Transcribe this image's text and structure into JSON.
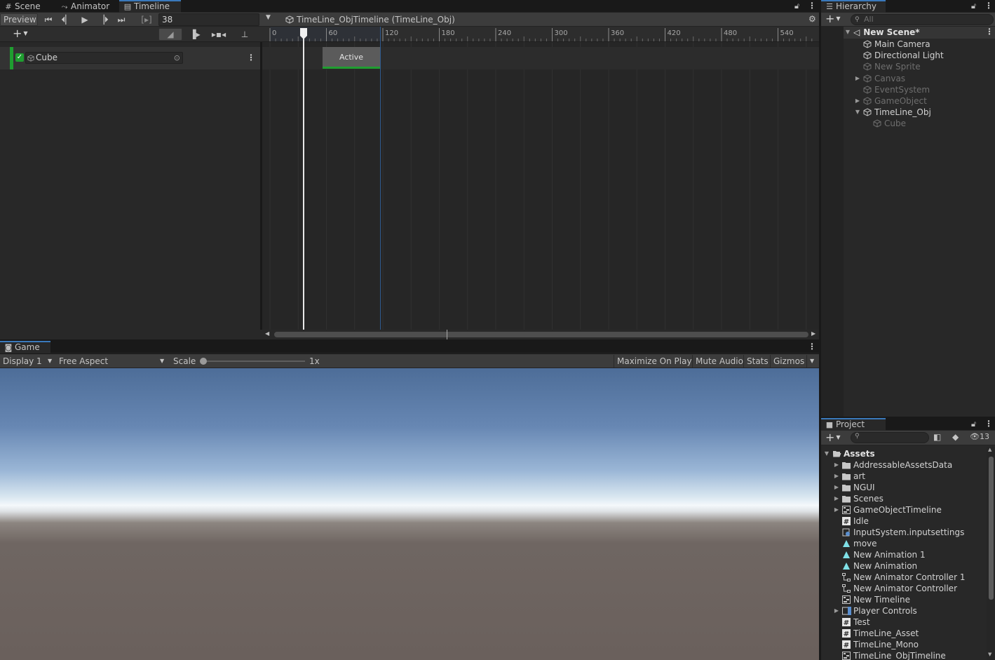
{
  "timeline_window": {
    "tabs": [
      {
        "label": "Scene",
        "icon": "grid-icon"
      },
      {
        "label": "Animator",
        "icon": "animator-icon"
      },
      {
        "label": "Timeline",
        "icon": "timeline-icon",
        "active": true
      }
    ],
    "preview_label": "Preview",
    "frame_value": "38",
    "breadcrumb": "TimeLine_ObjTimeline (TimeLine_Obj)",
    "track": {
      "name": "Cube",
      "enabled": true
    },
    "clip": {
      "label": "Active"
    },
    "ruler_ticks": [
      "0",
      "60",
      "120",
      "180",
      "240",
      "300",
      "360",
      "420",
      "480",
      "540"
    ],
    "add_button": "+"
  },
  "game_window": {
    "tab_label": "Game",
    "display_select": "Display 1",
    "aspect_select": "Free Aspect",
    "scale_label": "Scale",
    "scale_value": "1x",
    "maximize_label": "Maximize On Play",
    "mute_label": "Mute Audio",
    "stats_label": "Stats",
    "gizmos_label": "Gizmos"
  },
  "hierarchy": {
    "tab_label": "Hierarchy",
    "search_placeholder": "All",
    "scene_name": "New Scene*",
    "items": [
      {
        "label": "Main Camera",
        "active": true
      },
      {
        "label": "Directional Light",
        "active": true
      },
      {
        "label": "New Sprite",
        "active": false
      },
      {
        "label": "Canvas",
        "active": false
      },
      {
        "label": "EventSystem",
        "active": false
      },
      {
        "label": "GameObject",
        "active": false
      },
      {
        "label": "TimeLine_Obj",
        "active": true
      },
      {
        "label": "Cube",
        "active": false
      }
    ]
  },
  "project": {
    "tab_label": "Project",
    "hidden_count": "13",
    "root": "Assets",
    "items": [
      {
        "label": "AddressableAssetsData",
        "type": "folder"
      },
      {
        "label": "art",
        "type": "folder"
      },
      {
        "label": "NGUI",
        "type": "folder"
      },
      {
        "label": "Scenes",
        "type": "folder"
      },
      {
        "label": "GameObjectTimeline",
        "type": "timeline"
      },
      {
        "label": "Idle",
        "type": "script"
      },
      {
        "label": "InputSystem.inputsettings",
        "type": "settings"
      },
      {
        "label": "move",
        "type": "animation"
      },
      {
        "label": "New Animation 1",
        "type": "animation"
      },
      {
        "label": "New Animation",
        "type": "animation"
      },
      {
        "label": "New Animator Controller 1",
        "type": "controller"
      },
      {
        "label": "New Animator Controller",
        "type": "controller"
      },
      {
        "label": "New Timeline",
        "type": "timeline"
      },
      {
        "label": "Player Controls",
        "type": "input"
      },
      {
        "label": "Test",
        "type": "script"
      },
      {
        "label": "TimeLine_Asset",
        "type": "script"
      },
      {
        "label": "TimeLine_Mono",
        "type": "script"
      },
      {
        "label": "TimeLine_ObjTimeline",
        "type": "timeline"
      }
    ]
  },
  "colors": {
    "accent": "#3a79bb",
    "track_green": "#1f9e30",
    "clip_bg": "#5b5b5b"
  }
}
